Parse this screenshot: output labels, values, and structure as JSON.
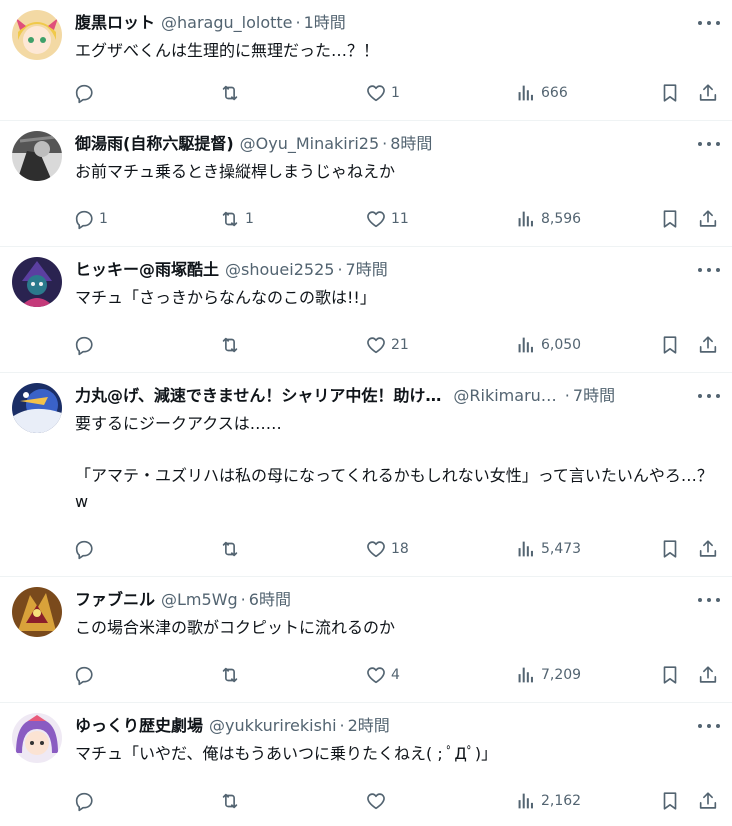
{
  "colors": {
    "text": "#0f1419",
    "muted": "#536471",
    "divider": "#eff3f4"
  },
  "tweets": [
    {
      "name": "腹黒ロット",
      "handle": "@haragu_lolotte",
      "time": "1時間",
      "text": "エグザべくんは生理的に無理だった…？！",
      "replies": "",
      "retweets": "",
      "likes": "1",
      "views": "666"
    },
    {
      "name": "御湯雨(自称六駆提督)",
      "handle": "@Oyu_Minakiri25",
      "time": "8時間",
      "text": "お前マチュ乗るとき操縦桿しまうじゃねえか",
      "replies": "1",
      "retweets": "1",
      "likes": "11",
      "views": "8,596"
    },
    {
      "name": "ヒッキー@雨塚酷土",
      "handle": "@shouei2525",
      "time": "7時間",
      "text": "マチュ「さっきからなんなのこの歌は!!」",
      "replies": "",
      "retweets": "",
      "likes": "21",
      "views": "6,050"
    },
    {
      "name": "力丸@げ、減速できません！シャリア中佐！助け…",
      "handle": "@Rikimaru…",
      "time": "7時間",
      "text": "要するにジークアクスは……\n\n「アマテ・ユズリハは私の母になってくれるかもしれない女性」って言いたいんやろ…？w",
      "replies": "",
      "retweets": "",
      "likes": "18",
      "views": "5,473"
    },
    {
      "name": "ファブニル",
      "handle": "@Lm5Wg",
      "time": "6時間",
      "text": "この場合米津の歌がコクピットに流れるのか",
      "replies": "",
      "retweets": "",
      "likes": "4",
      "views": "7,209"
    },
    {
      "name": "ゆっくり歴史劇場",
      "handle": "@yukkurirekishi",
      "time": "2時間",
      "text": "マチュ「いやだ、俺はもうあいつに乗りたくねえ( ; ﾟДﾟ)」",
      "replies": "",
      "retweets": "",
      "likes": "",
      "views": "2,162"
    }
  ]
}
